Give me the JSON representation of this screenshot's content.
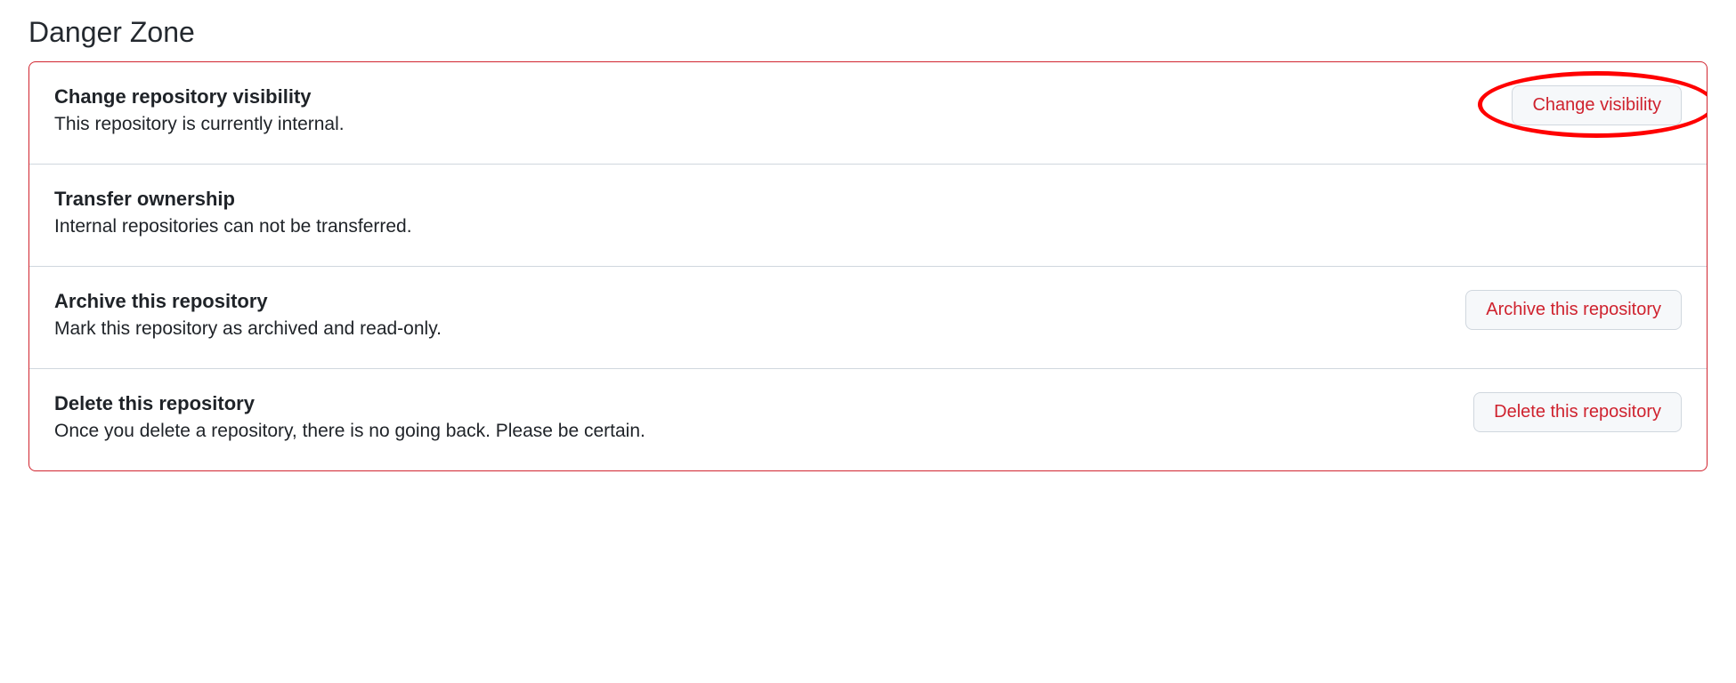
{
  "section": {
    "heading": "Danger Zone"
  },
  "rows": {
    "visibility": {
      "title": "Change repository visibility",
      "desc": "This repository is currently internal.",
      "button": "Change visibility"
    },
    "transfer": {
      "title": "Transfer ownership",
      "desc": "Internal repositories can not be transferred."
    },
    "archive": {
      "title": "Archive this repository",
      "desc": "Mark this repository as archived and read-only.",
      "button": "Archive this repository"
    },
    "delete": {
      "title": "Delete this repository",
      "desc": "Once you delete a repository, there is no going back. Please be certain.",
      "button": "Delete this repository"
    }
  }
}
